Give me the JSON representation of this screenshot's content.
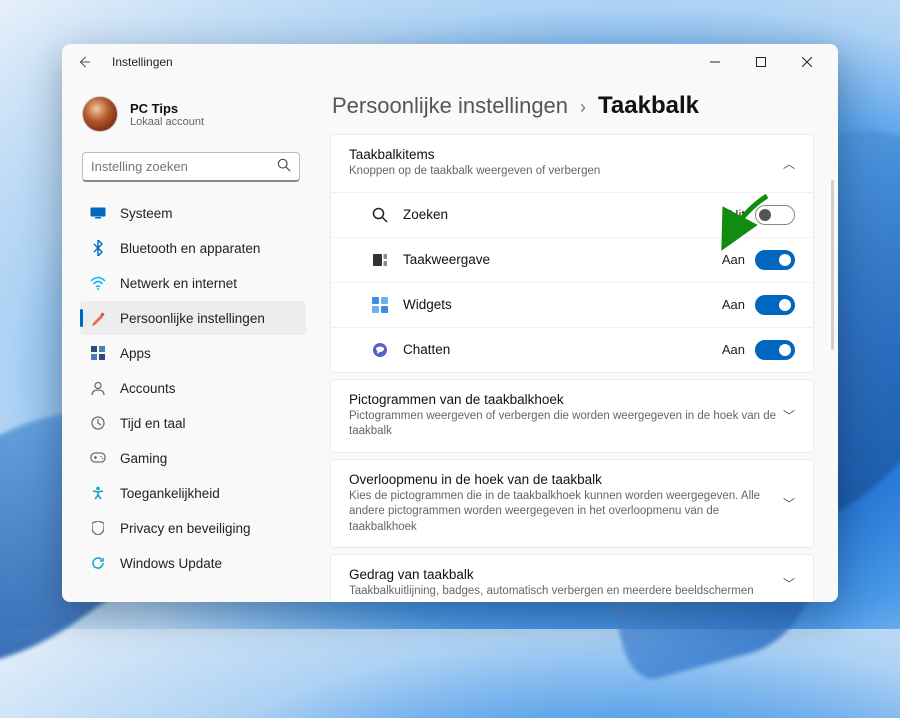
{
  "window": {
    "title": "Instellingen"
  },
  "profile": {
    "name": "PC Tips",
    "sub": "Lokaal account"
  },
  "search": {
    "placeholder": "Instelling zoeken"
  },
  "nav": {
    "items": [
      {
        "id": "system",
        "label": "Systeem",
        "color": "#0067c0"
      },
      {
        "id": "bluetooth",
        "label": "Bluetooth en apparaten",
        "color": "#0067c0"
      },
      {
        "id": "network",
        "label": "Netwerk en internet",
        "color": "#00b7ff"
      },
      {
        "id": "personalization",
        "label": "Persoonlijke instellingen",
        "color": "#e17155"
      },
      {
        "id": "apps",
        "label": "Apps",
        "color": "#2a4b7c"
      },
      {
        "id": "accounts",
        "label": "Accounts",
        "color": "#6e6e6e"
      },
      {
        "id": "time",
        "label": "Tijd en taal",
        "color": "#6e6e6e"
      },
      {
        "id": "gaming",
        "label": "Gaming",
        "color": "#6e6e6e"
      },
      {
        "id": "accessibility",
        "label": "Toegankelijkheid",
        "color": "#0ea5c6"
      },
      {
        "id": "privacy",
        "label": "Privacy en beveiliging",
        "color": "#6e6e6e"
      },
      {
        "id": "update",
        "label": "Windows Update",
        "color": "#0ea5c6"
      }
    ],
    "selected": 3
  },
  "breadcrumb": {
    "parent": "Persoonlijke instellingen",
    "current": "Taakbalk"
  },
  "sections": {
    "items": {
      "title": "Taakbalkitems",
      "sub": "Knoppen op de taakbalk weergeven of verbergen",
      "expanded": true,
      "rows": [
        {
          "id": "search",
          "label": "Zoeken",
          "state": "Uit",
          "on": false
        },
        {
          "id": "taskview",
          "label": "Taakweergave",
          "state": "Aan",
          "on": true
        },
        {
          "id": "widgets",
          "label": "Widgets",
          "state": "Aan",
          "on": true
        },
        {
          "id": "chat",
          "label": "Chatten",
          "state": "Aan",
          "on": true
        }
      ]
    },
    "corner_icons": {
      "title": "Pictogrammen van de taakbalkhoek",
      "sub": "Pictogrammen weergeven of verbergen die worden weergegeven in de hoek van de taakbalk"
    },
    "overflow": {
      "title": "Overloopmenu in de hoek van de taakbalk",
      "sub": "Kies de pictogrammen die in de taakbalkhoek kunnen worden weergegeven. Alle andere pictogrammen worden weergegeven in het overloopmenu van de taakbalkhoek"
    },
    "behavior": {
      "title": "Gedrag van taakbalk",
      "sub": "Taakbalkuitlijning, badges, automatisch verbergen en meerdere beeldschermen"
    }
  },
  "annotation": {
    "arrow_color": "#118c11"
  }
}
